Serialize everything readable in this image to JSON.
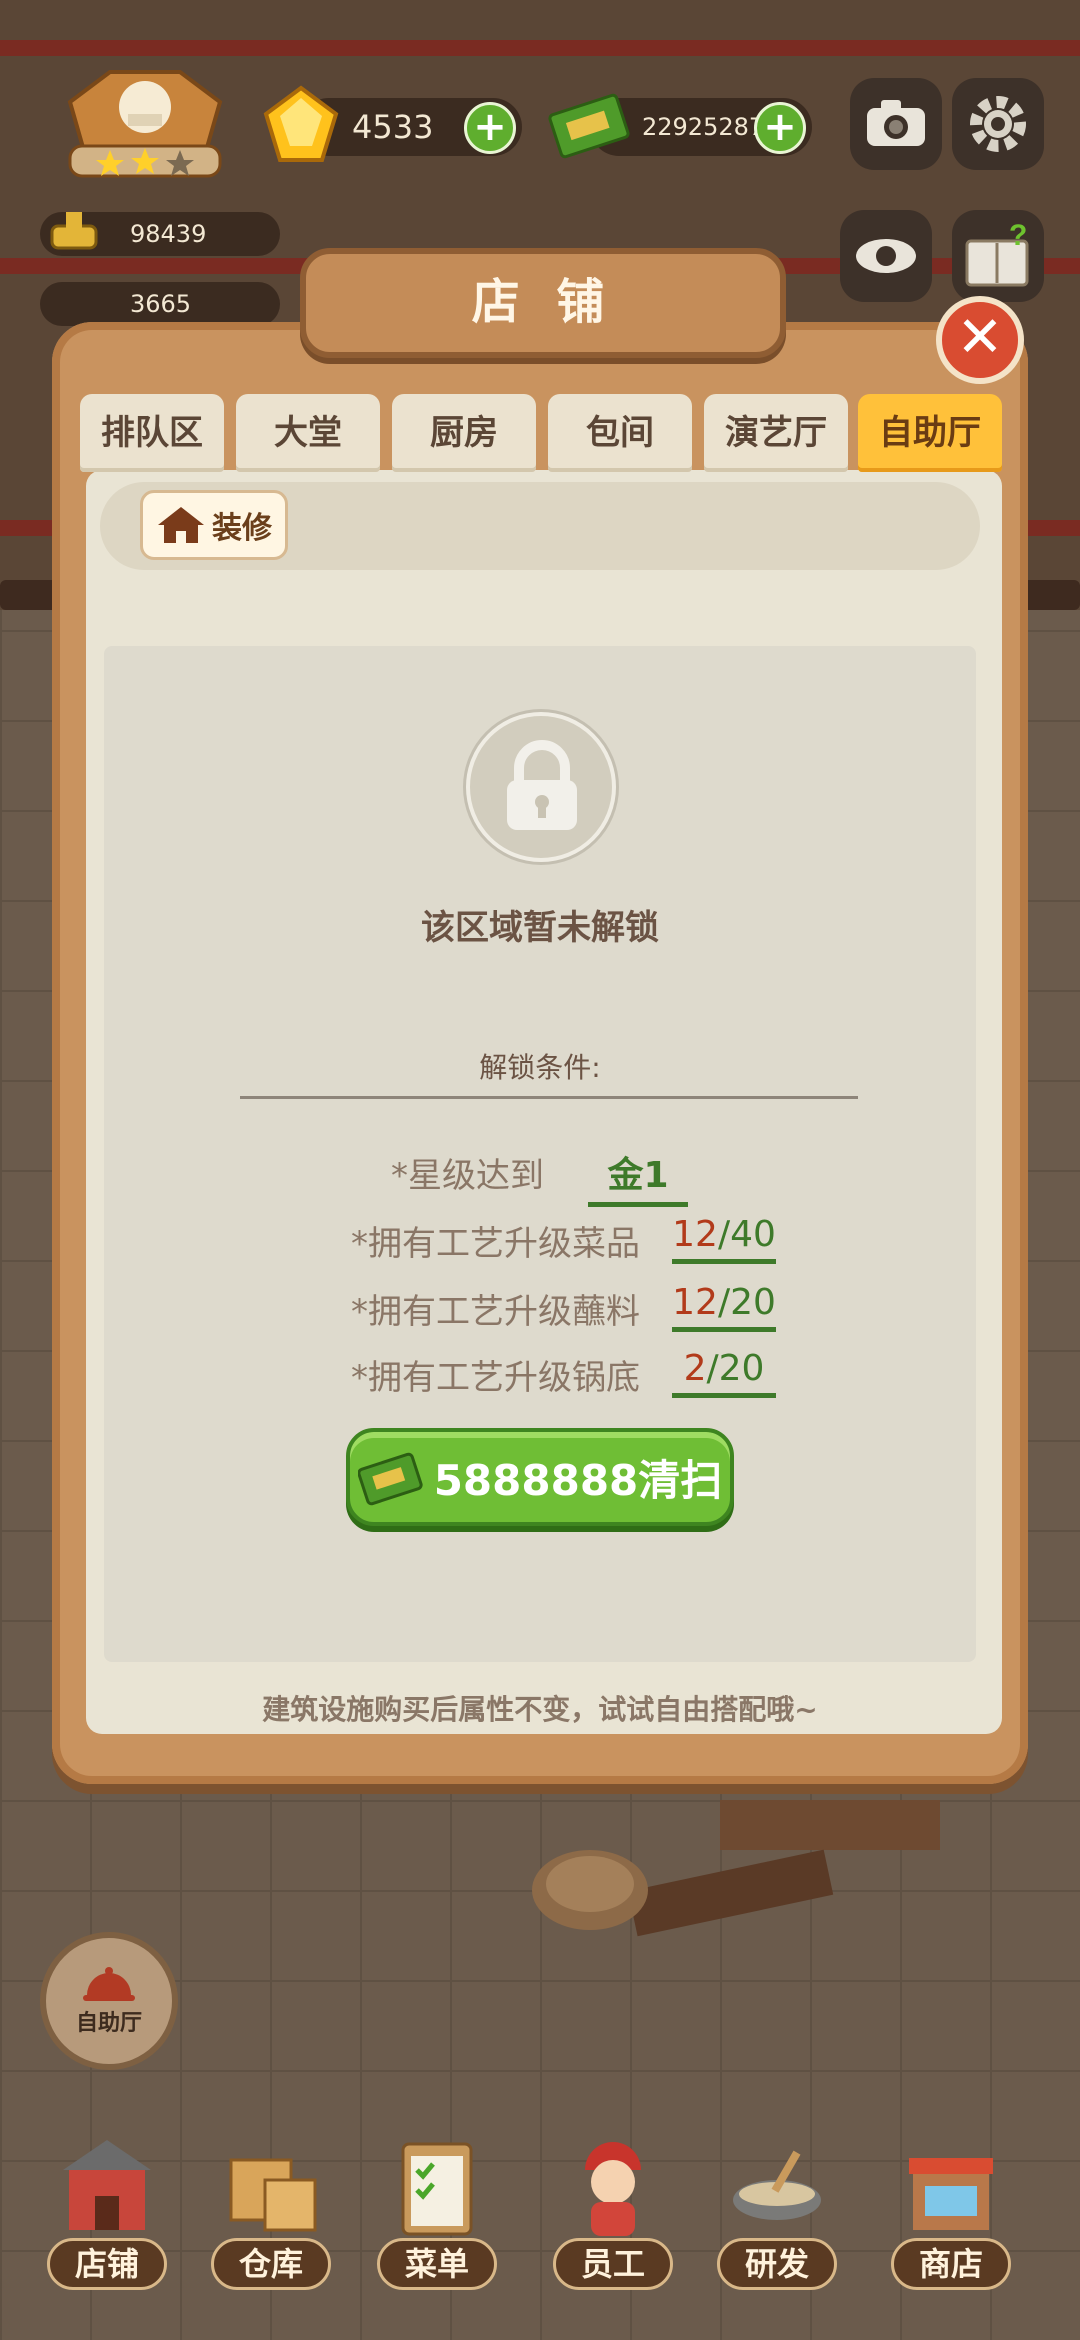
{
  "hud": {
    "gems": "4533",
    "cash": "22925287",
    "res_a": "98439",
    "res_b": "3665"
  },
  "panel": {
    "title": "店 铺",
    "tabs": [
      "排队区",
      "大堂",
      "厨房",
      "包间",
      "演艺厅",
      "自助厅"
    ],
    "active_tab": "自助厅",
    "decor_label": "装修",
    "locked_message": "该区域暂未解锁",
    "conditions_title": "解锁条件:",
    "requirements": [
      {
        "label": "*星级达到",
        "value": "金1"
      },
      {
        "label": "*拥有工艺升级菜品",
        "current": "12",
        "total": "/40"
      },
      {
        "label": "*拥有工艺升级蘸料",
        "current": "12",
        "total": "/20"
      },
      {
        "label": "*拥有工艺升级锅底",
        "current": "2",
        "total": "/20"
      }
    ],
    "sweep_button": "5888888清扫",
    "tip": "建筑设施购买后属性不变，试试自由搭配哦~"
  },
  "side_button": "自助厅",
  "bottom_nav": [
    "店铺",
    "仓库",
    "菜单",
    "员工",
    "研发",
    "商店"
  ],
  "icons": [
    "chef-star-badge-icon",
    "gem-icon",
    "cash-icon",
    "camera-icon",
    "gear-icon",
    "eye-icon",
    "help-book-icon",
    "close-icon",
    "house-icon",
    "lock-icon",
    "cloche-icon"
  ],
  "colors": {
    "active_tab": "#ffc13a",
    "sweep_button": "#6fbe35",
    "close_button": "#d94c31"
  }
}
